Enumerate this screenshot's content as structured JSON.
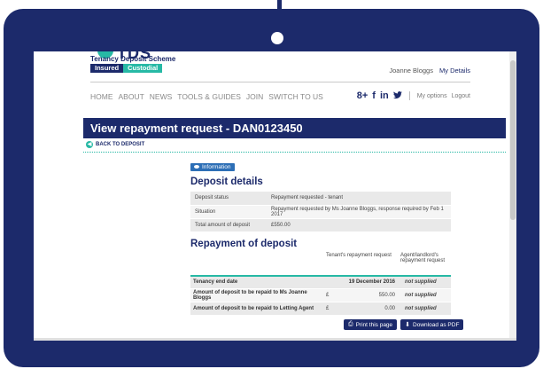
{
  "logo": {
    "letters": "TDS",
    "name": "Tenancy Deposit Scheme",
    "tag_insured": "Insured",
    "tag_custodial": "Custodial"
  },
  "user": {
    "name": "Joanne Bloggs",
    "my_details": "My Details"
  },
  "nav": [
    "HOME",
    "ABOUT",
    "NEWS",
    "TOOLS & GUIDES",
    "JOIN",
    "SWITCH TO US"
  ],
  "right_nav": {
    "google": "8+",
    "facebook": "f",
    "linkedin": "in",
    "twitter": "🐦",
    "my_options": "My options",
    "logout": "Logout"
  },
  "page": {
    "title": "View repayment request - DAN0123450",
    "back_label": "BACK TO DEPOSIT"
  },
  "info_badge": "Information",
  "deposit_details": {
    "heading": "Deposit details",
    "rows": [
      {
        "label": "Deposit status",
        "value": "Repayment requested - tenant"
      },
      {
        "label": "Situation",
        "value": "Repayment requested by Ms Joanne Bloggs, response required by Feb 1 2017"
      },
      {
        "label": "Total amount of deposit",
        "value": "£550.00"
      }
    ]
  },
  "repayment": {
    "heading": "Repayment of deposit",
    "col_tenant": "Tenant's repayment request",
    "col_agent": "Agent/landlord's repayment request",
    "rows": [
      {
        "label": "Tenancy end date",
        "currency": "",
        "tenant": "19 December 2016",
        "agent": "not supplied"
      },
      {
        "label": "Amount of deposit to be repaid to Ms Joanne Bloggs",
        "currency": "£",
        "tenant": "550.00",
        "agent": "not supplied"
      },
      {
        "label": "Amount of deposit to be repaid to Letting Agent",
        "currency": "£",
        "tenant": "0.00",
        "agent": "not supplied"
      }
    ]
  },
  "actions": {
    "print": "Print this page",
    "download": "Download as PDF"
  },
  "colors": {
    "navy": "#1c2a6b",
    "teal": "#27b9a5",
    "info_blue": "#2d6fb6"
  }
}
